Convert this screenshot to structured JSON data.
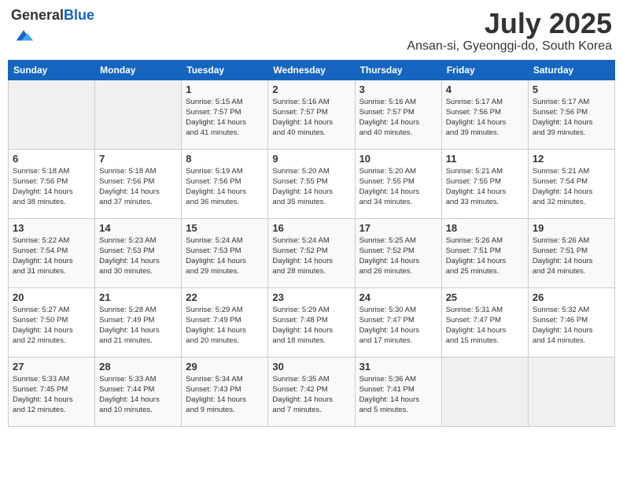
{
  "logo": {
    "general": "General",
    "blue": "Blue"
  },
  "header": {
    "month": "July 2025",
    "location": "Ansan-si, Gyeonggi-do, South Korea"
  },
  "weekdays": [
    "Sunday",
    "Monday",
    "Tuesday",
    "Wednesday",
    "Thursday",
    "Friday",
    "Saturday"
  ],
  "weeks": [
    [
      {
        "day": "",
        "detail": ""
      },
      {
        "day": "",
        "detail": ""
      },
      {
        "day": "1",
        "detail": "Sunrise: 5:15 AM\nSunset: 7:57 PM\nDaylight: 14 hours\nand 41 minutes."
      },
      {
        "day": "2",
        "detail": "Sunrise: 5:16 AM\nSunset: 7:57 PM\nDaylight: 14 hours\nand 40 minutes."
      },
      {
        "day": "3",
        "detail": "Sunrise: 5:16 AM\nSunset: 7:57 PM\nDaylight: 14 hours\nand 40 minutes."
      },
      {
        "day": "4",
        "detail": "Sunrise: 5:17 AM\nSunset: 7:56 PM\nDaylight: 14 hours\nand 39 minutes."
      },
      {
        "day": "5",
        "detail": "Sunrise: 5:17 AM\nSunset: 7:56 PM\nDaylight: 14 hours\nand 39 minutes."
      }
    ],
    [
      {
        "day": "6",
        "detail": "Sunrise: 5:18 AM\nSunset: 7:56 PM\nDaylight: 14 hours\nand 38 minutes."
      },
      {
        "day": "7",
        "detail": "Sunrise: 5:18 AM\nSunset: 7:56 PM\nDaylight: 14 hours\nand 37 minutes."
      },
      {
        "day": "8",
        "detail": "Sunrise: 5:19 AM\nSunset: 7:56 PM\nDaylight: 14 hours\nand 36 minutes."
      },
      {
        "day": "9",
        "detail": "Sunrise: 5:20 AM\nSunset: 7:55 PM\nDaylight: 14 hours\nand 35 minutes."
      },
      {
        "day": "10",
        "detail": "Sunrise: 5:20 AM\nSunset: 7:55 PM\nDaylight: 14 hours\nand 34 minutes."
      },
      {
        "day": "11",
        "detail": "Sunrise: 5:21 AM\nSunset: 7:55 PM\nDaylight: 14 hours\nand 33 minutes."
      },
      {
        "day": "12",
        "detail": "Sunrise: 5:21 AM\nSunset: 7:54 PM\nDaylight: 14 hours\nand 32 minutes."
      }
    ],
    [
      {
        "day": "13",
        "detail": "Sunrise: 5:22 AM\nSunset: 7:54 PM\nDaylight: 14 hours\nand 31 minutes."
      },
      {
        "day": "14",
        "detail": "Sunrise: 5:23 AM\nSunset: 7:53 PM\nDaylight: 14 hours\nand 30 minutes."
      },
      {
        "day": "15",
        "detail": "Sunrise: 5:24 AM\nSunset: 7:53 PM\nDaylight: 14 hours\nand 29 minutes."
      },
      {
        "day": "16",
        "detail": "Sunrise: 5:24 AM\nSunset: 7:52 PM\nDaylight: 14 hours\nand 28 minutes."
      },
      {
        "day": "17",
        "detail": "Sunrise: 5:25 AM\nSunset: 7:52 PM\nDaylight: 14 hours\nand 26 minutes."
      },
      {
        "day": "18",
        "detail": "Sunrise: 5:26 AM\nSunset: 7:51 PM\nDaylight: 14 hours\nand 25 minutes."
      },
      {
        "day": "19",
        "detail": "Sunrise: 5:26 AM\nSunset: 7:51 PM\nDaylight: 14 hours\nand 24 minutes."
      }
    ],
    [
      {
        "day": "20",
        "detail": "Sunrise: 5:27 AM\nSunset: 7:50 PM\nDaylight: 14 hours\nand 22 minutes."
      },
      {
        "day": "21",
        "detail": "Sunrise: 5:28 AM\nSunset: 7:49 PM\nDaylight: 14 hours\nand 21 minutes."
      },
      {
        "day": "22",
        "detail": "Sunrise: 5:29 AM\nSunset: 7:49 PM\nDaylight: 14 hours\nand 20 minutes."
      },
      {
        "day": "23",
        "detail": "Sunrise: 5:29 AM\nSunset: 7:48 PM\nDaylight: 14 hours\nand 18 minutes."
      },
      {
        "day": "24",
        "detail": "Sunrise: 5:30 AM\nSunset: 7:47 PM\nDaylight: 14 hours\nand 17 minutes."
      },
      {
        "day": "25",
        "detail": "Sunrise: 5:31 AM\nSunset: 7:47 PM\nDaylight: 14 hours\nand 15 minutes."
      },
      {
        "day": "26",
        "detail": "Sunrise: 5:32 AM\nSunset: 7:46 PM\nDaylight: 14 hours\nand 14 minutes."
      }
    ],
    [
      {
        "day": "27",
        "detail": "Sunrise: 5:33 AM\nSunset: 7:45 PM\nDaylight: 14 hours\nand 12 minutes."
      },
      {
        "day": "28",
        "detail": "Sunrise: 5:33 AM\nSunset: 7:44 PM\nDaylight: 14 hours\nand 10 minutes."
      },
      {
        "day": "29",
        "detail": "Sunrise: 5:34 AM\nSunset: 7:43 PM\nDaylight: 14 hours\nand 9 minutes."
      },
      {
        "day": "30",
        "detail": "Sunrise: 5:35 AM\nSunset: 7:42 PM\nDaylight: 14 hours\nand 7 minutes."
      },
      {
        "day": "31",
        "detail": "Sunrise: 5:36 AM\nSunset: 7:41 PM\nDaylight: 14 hours\nand 5 minutes."
      },
      {
        "day": "",
        "detail": ""
      },
      {
        "day": "",
        "detail": ""
      }
    ]
  ]
}
